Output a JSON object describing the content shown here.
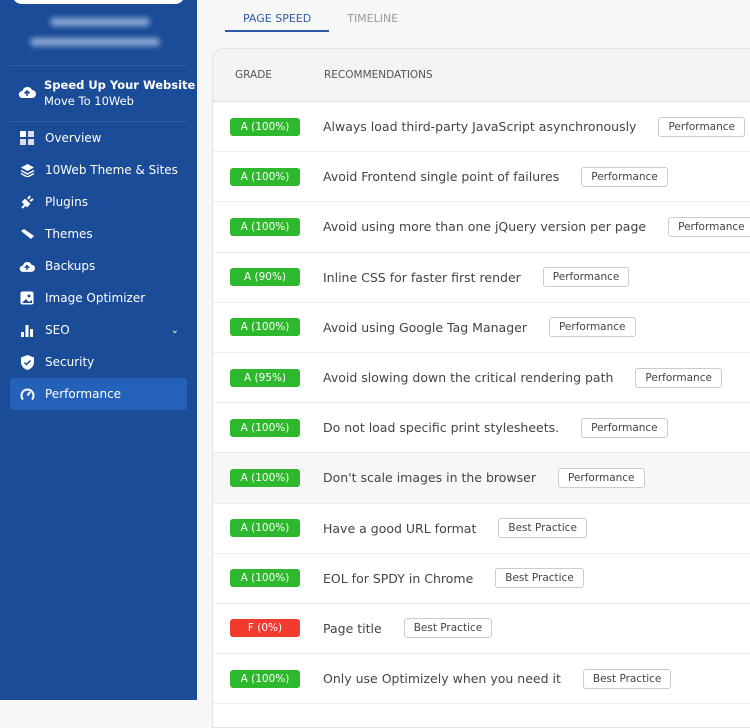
{
  "sidebar": {
    "promo": {
      "title": "Speed Up Your Website",
      "subtitle": "Move To 10Web"
    },
    "items": [
      {
        "label": "Overview",
        "icon": "grid-icon"
      },
      {
        "label": "10Web Theme & Sites",
        "icon": "layers-icon"
      },
      {
        "label": "Plugins",
        "icon": "plug-icon"
      },
      {
        "label": "Themes",
        "icon": "brush-icon"
      },
      {
        "label": "Backups",
        "icon": "cloud-upload-icon"
      },
      {
        "label": "Image Optimizer",
        "icon": "image-icon"
      },
      {
        "label": "SEO",
        "icon": "bar-chart-icon"
      },
      {
        "label": "Security",
        "icon": "shield-icon"
      },
      {
        "label": "Performance",
        "icon": "speedometer-icon"
      }
    ]
  },
  "tabs": [
    {
      "label": "PAGE SPEED"
    },
    {
      "label": "TIMELINE"
    }
  ],
  "table": {
    "headers": [
      "GRADE",
      "RECOMMENDATIONS"
    ],
    "rows": [
      {
        "grade": "A (100%)",
        "text": "Always load third-party JavaScript asynchronously",
        "tag": "Performance"
      },
      {
        "grade": "A (100%)",
        "text": "Avoid Frontend single point of failures",
        "tag": "Performance"
      },
      {
        "grade": "A (100%)",
        "text": "Avoid using more than one jQuery version per page",
        "tag": "Performance"
      },
      {
        "grade": "A (90%)",
        "text": "Inline CSS for faster first render",
        "tag": "Performance"
      },
      {
        "grade": "A (100%)",
        "text": "Avoid using Google Tag Manager",
        "tag": "Performance"
      },
      {
        "grade": "A (95%)",
        "text": "Avoid slowing down the critical rendering path",
        "tag": "Performance"
      },
      {
        "grade": "A (100%)",
        "text": "Do not load specific print stylesheets.",
        "tag": "Performance"
      },
      {
        "grade": "A (100%)",
        "text": "Don't scale images in the browser",
        "tag": "Performance"
      },
      {
        "grade": "A (100%)",
        "text": "Have a good URL format",
        "tag": "Best Practice"
      },
      {
        "grade": "A (100%)",
        "text": "EOL for SPDY in Chrome",
        "tag": "Best Practice"
      },
      {
        "grade": "F (0%)",
        "text": "Page title",
        "tag": "Best Practice"
      },
      {
        "grade": "A (100%)",
        "text": "Only use Optimizely when you need it",
        "tag": "Best Practice"
      }
    ]
  },
  "colors": {
    "sidebar": "#1b4c98",
    "active": "#2461b8",
    "pass": "#2db82d",
    "fail": "#f23a2f"
  }
}
